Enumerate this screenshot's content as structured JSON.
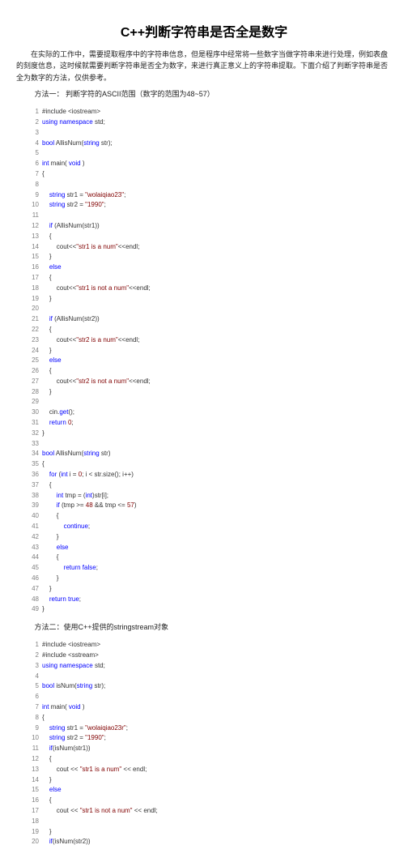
{
  "title": "C++判断字符串是否全是数字",
  "paragraph": "在实际的工作中，需要提取程序中的字符串信息，但是程序中经常将一些数字当做字符串来进行处理，例如表盘的刻度信息，这时候就需要判断字符串是否全为数字，来进行真正意义上的字符串提取。下面介绍了判断字符串是否全为数字的方法，仅供参考。",
  "method1": "方法一： 判断字符的ASCII范围（数字的范围为48~57）",
  "method2": "方法二：使用C++提供的stringstream对象",
  "code1": [
    {
      "n": 1,
      "h": "#include &lt;iostream&gt;"
    },
    {
      "n": 2,
      "h": "<span class='kw'>using namespace</span> std;"
    },
    {
      "n": 3,
      "h": ""
    },
    {
      "n": 4,
      "h": "<span class='typ'>bool</span> AllisNum(<span class='kw'>string</span> str);"
    },
    {
      "n": 5,
      "h": ""
    },
    {
      "n": 6,
      "h": "<span class='typ'>int</span> main( <span class='typ'>void</span> )"
    },
    {
      "n": 7,
      "h": "{"
    },
    {
      "n": 8,
      "h": ""
    },
    {
      "n": 9,
      "h": "    <span class='kw'>string</span> str1 = <span class='str'>\"wolaiqiao23\"</span>;"
    },
    {
      "n": 10,
      "h": "    <span class='kw'>string</span> str2 = <span class='str'>\"1990\"</span>;"
    },
    {
      "n": 11,
      "h": ""
    },
    {
      "n": 12,
      "h": "    <span class='kw'>if</span> (AllisNum(str1))"
    },
    {
      "n": 13,
      "h": "    {"
    },
    {
      "n": 14,
      "h": "        cout&lt;&lt;<span class='str'>\"str1 is a num\"</span>&lt;&lt;endl;"
    },
    {
      "n": 15,
      "h": "    }"
    },
    {
      "n": 16,
      "h": "    <span class='kw'>else</span>"
    },
    {
      "n": 17,
      "h": "    {"
    },
    {
      "n": 18,
      "h": "        cout&lt;&lt;<span class='str'>\"str1 is not a num\"</span>&lt;&lt;endl;"
    },
    {
      "n": 19,
      "h": "    }"
    },
    {
      "n": 20,
      "h": ""
    },
    {
      "n": 21,
      "h": "    <span class='kw'>if</span> (AllisNum(str2))"
    },
    {
      "n": 22,
      "h": "    {"
    },
    {
      "n": 23,
      "h": "        cout&lt;&lt;<span class='str'>\"str2 is a num\"</span>&lt;&lt;endl;"
    },
    {
      "n": 24,
      "h": "    }"
    },
    {
      "n": 25,
      "h": "    <span class='kw'>else</span>"
    },
    {
      "n": 26,
      "h": "    {"
    },
    {
      "n": 27,
      "h": "        cout&lt;&lt;<span class='str'>\"str2 is not a num\"</span>&lt;&lt;endl;"
    },
    {
      "n": 28,
      "h": "    }"
    },
    {
      "n": 29,
      "h": ""
    },
    {
      "n": 30,
      "h": "    cin.<span class='kw'>get</span>();"
    },
    {
      "n": 31,
      "h": "    <span class='kw'>return</span> <span class='num'>0</span>;"
    },
    {
      "n": 32,
      "h": "}"
    },
    {
      "n": 33,
      "h": ""
    },
    {
      "n": 34,
      "h": "<span class='typ'>bool</span> AllisNum(<span class='kw'>string</span> str)"
    },
    {
      "n": 35,
      "h": "{"
    },
    {
      "n": 36,
      "h": "    <span class='kw'>for</span> (<span class='typ'>int</span> i = <span class='num'>0</span>; i &lt; str.size(); i++)"
    },
    {
      "n": 37,
      "h": "    {"
    },
    {
      "n": 38,
      "h": "        <span class='typ'>int</span> tmp = (<span class='typ'>int</span>)str[i];"
    },
    {
      "n": 39,
      "h": "        <span class='kw'>if</span> (tmp &gt;= <span class='num'>48</span> &amp;&amp; tmp &lt;= <span class='num'>57</span>)"
    },
    {
      "n": 40,
      "h": "        {"
    },
    {
      "n": 41,
      "h": "            <span class='kw'>continue</span>;"
    },
    {
      "n": 42,
      "h": "        }"
    },
    {
      "n": 43,
      "h": "        <span class='kw'>else</span>"
    },
    {
      "n": 44,
      "h": "        {"
    },
    {
      "n": 45,
      "h": "            <span class='kw'>return false</span>;"
    },
    {
      "n": 46,
      "h": "        }"
    },
    {
      "n": 47,
      "h": "    }"
    },
    {
      "n": 48,
      "h": "    <span class='kw'>return true</span>;"
    },
    {
      "n": 49,
      "h": "}"
    }
  ],
  "code2": [
    {
      "n": 1,
      "h": "#include &lt;iostream&gt;"
    },
    {
      "n": 2,
      "h": "#include &lt;sstream&gt;"
    },
    {
      "n": 3,
      "h": "<span class='kw'>using namespace</span> std;"
    },
    {
      "n": 4,
      "h": ""
    },
    {
      "n": 5,
      "h": "<span class='typ'>bool</span> isNum(<span class='kw'>string</span> str);"
    },
    {
      "n": 6,
      "h": ""
    },
    {
      "n": 7,
      "h": "<span class='typ'>int</span> main( <span class='typ'>void</span> )"
    },
    {
      "n": 8,
      "h": "{"
    },
    {
      "n": 9,
      "h": "    <span class='kw'>string</span> str1 = <span class='str'>\"wolaiqiao23r\"</span>;"
    },
    {
      "n": 10,
      "h": "    <span class='kw'>string</span> str2 = <span class='str'>\"1990\"</span>;"
    },
    {
      "n": 11,
      "h": "    <span class='kw'>if</span>(isNum(str1))"
    },
    {
      "n": 12,
      "h": "    {"
    },
    {
      "n": 13,
      "h": "        cout &lt;&lt; <span class='str'>\"str1 is a num\"</span> &lt;&lt; endl;"
    },
    {
      "n": 14,
      "h": "    }"
    },
    {
      "n": 15,
      "h": "    <span class='kw'>else</span>"
    },
    {
      "n": 16,
      "h": "    {"
    },
    {
      "n": 17,
      "h": "        cout &lt;&lt; <span class='str'>\"str1 is not a num\"</span> &lt;&lt; endl;"
    },
    {
      "n": 18,
      "h": ""
    },
    {
      "n": 19,
      "h": "    }"
    },
    {
      "n": 20,
      "h": "    <span class='kw'>if</span>(isNum(str2))"
    }
  ]
}
